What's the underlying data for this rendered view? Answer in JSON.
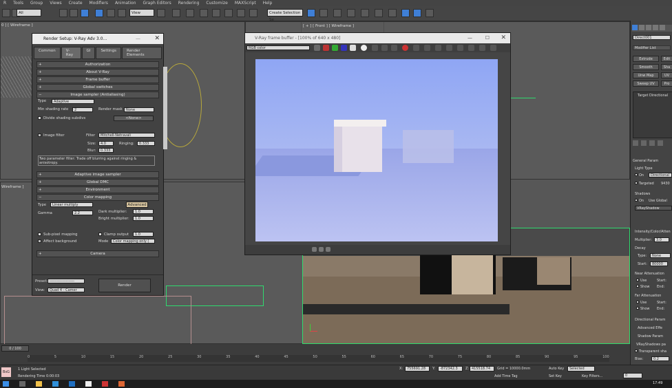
{
  "menu": [
    "R",
    "Tools",
    "Group",
    "Views",
    "Create",
    "Modifiers",
    "Animation",
    "Graph Editors",
    "Rendering",
    "Customize",
    "MAXScript",
    "Help"
  ],
  "toolbar": {
    "filter": "All",
    "view": "View",
    "selection_set": "Create Selection Se"
  },
  "viewports": {
    "top_left": "0 ] [ Wireframe ]",
    "front": "[ + ] [ Front ] [ Wireframe ]",
    "left": "Wireframe ]",
    "camera": "Direct001"
  },
  "render_setup": {
    "title": "Render Setup: V-Ray Adv 3.0...",
    "tabs": [
      "Common",
      "V-Ray",
      "GI",
      "Settings",
      "Render Elements"
    ],
    "rollouts_top": [
      "Authorization",
      "About V-Ray",
      "Frame buffer",
      "Global switches",
      "Image sampler (Antialiasing)"
    ],
    "type_label": "Type",
    "type_value": "Adaptive",
    "min_shading_label": "Min shading rate",
    "min_shading_value": "2",
    "render_mask_label": "Render mask",
    "render_mask_value": "None",
    "divide_label": "Divide shading subdivs",
    "none_btn": "<None>",
    "image_filter_label": "Image filter",
    "filter_label": "Filter",
    "filter_value": "Mitchell-Netravali",
    "size_label": "Size:",
    "size_value": "4.0",
    "ringing_label": "Ringing:",
    "ringing_value": "0.333",
    "blur_label": "Blur:",
    "blur_value": "0.333",
    "filter_desc": "Two parameter filter: Trade off blurring against ringing & anisotropy.",
    "rollouts_mid": [
      "Adaptive image sampler",
      "Global DMC",
      "Environment",
      "Color mapping"
    ],
    "cm_type_label": "Type",
    "cm_type_value": "Linear multiply",
    "advanced_btn": "Advanced",
    "gamma_label": "Gamma",
    "gamma_value": "2.2",
    "dark_label": "Dark multiplier:",
    "dark_value": "1.0",
    "bright_label": "Bright multiplier:",
    "bright_value": "1.0",
    "subpixel_label": "Sub-pixel mapping",
    "clamp_label": "Clamp output",
    "clamp_value": "1.0",
    "affect_bg_label": "Affect background",
    "mode_label": "Mode",
    "mode_value": "Color mapping only (",
    "camera_rollout": "Camera",
    "preset_label": "Preset:",
    "preset_value": "--------------------",
    "view_label": "View:",
    "view_value": "Quad 4 - Camer",
    "render_btn": "Render"
  },
  "vfb": {
    "title": "V-Ray frame buffer - [100% of 640 x 480]",
    "channel": "RGB color"
  },
  "command_panel": {
    "object_name": "Direct001",
    "modifier_list": "Modifier List",
    "buttons": [
      "Extrude",
      "Smooth",
      "Unw Map",
      "Sweep UV",
      "Edit",
      "Sha",
      "UV",
      "Pro"
    ],
    "stack_item": "Target Directional",
    "general_params": "General Param",
    "light_type": "Light Type",
    "on_label": "On",
    "light_type_value": "Directional",
    "targeted_label": "Targeted",
    "targeted_value": "9430",
    "shadows": "Shadows",
    "shadows_on": "On",
    "use_global": "Use Global",
    "shadow_type": "VRayShadow",
    "intensity": "Intensity/Color/Atten",
    "multiplier_label": "Multiplier:",
    "multiplier_value": "3.0",
    "decay": "Decay",
    "decay_type_label": "Type:",
    "decay_type_value": "None",
    "start_label": "Start:",
    "start_value": "80000",
    "near_atten": "Near Attenuation",
    "far_atten": "Far Attenuation",
    "use_label": "Use",
    "show_label": "Show",
    "end_label": "End:",
    "directional_params": "Directional Param",
    "advanced_effects": "Advanced Effe",
    "shadow_params": "Shadow Param",
    "vrayshadows": "VRayShadows pa",
    "transparent": "Transparent sha",
    "bias_label": "Bias:",
    "bias_value": "0.2"
  },
  "timeline": {
    "frame": "0 / 100",
    "ticks": [
      "0",
      "5",
      "10",
      "15",
      "20",
      "25",
      "30",
      "35",
      "40",
      "45",
      "50",
      "55",
      "60",
      "65",
      "70",
      "75",
      "80",
      "85",
      "90",
      "95",
      "100"
    ]
  },
  "status": {
    "selected": "1 Light Selected",
    "rendering_time": "Rendering Time 0:00:03",
    "x_value": "755691.28",
    "y_value": "-872342.3",
    "z_value": "415518.74",
    "grid": "Grid = 10000.0mm",
    "auto_key": "Auto Key",
    "set_key": "Set Key",
    "selected_dropdown": "Selected",
    "key_filters": "Key Filters...",
    "add_time_tag": "Add Time Tag",
    "frame_value": "0",
    "script_label": "BsG"
  },
  "clock": "17:49"
}
